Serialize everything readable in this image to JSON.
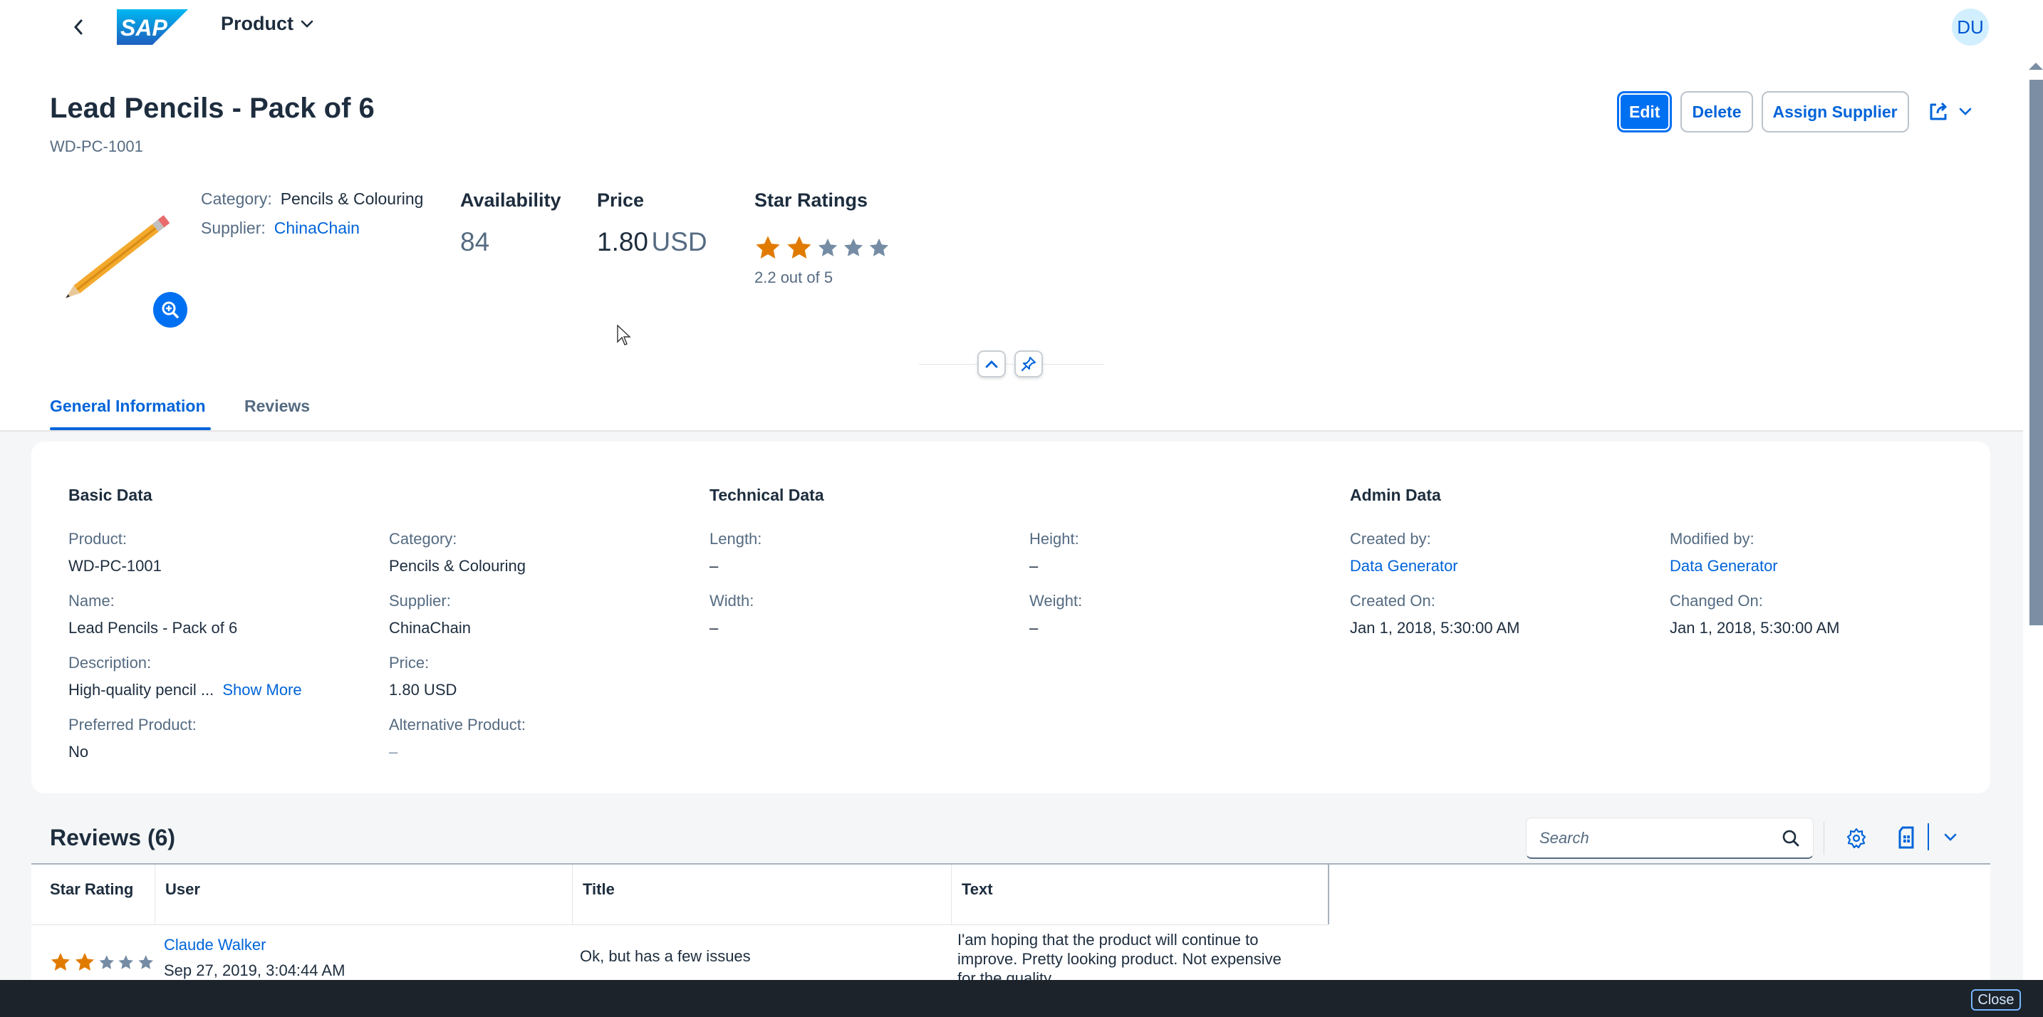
{
  "shell": {
    "app_title": "Product",
    "logo_text": "SAP",
    "avatar_initials": "DU"
  },
  "object_header": {
    "title": "Lead Pencils - Pack of 6",
    "subtitle": "WD-PC-1001",
    "category_label": "Category:",
    "category_value": "Pencils & Colouring",
    "supplier_label": "Supplier:",
    "supplier_value": "ChinaChain",
    "availability_label": "Availability",
    "availability_value": "84",
    "price_label": "Price",
    "price_value": "1.80",
    "price_unit": "USD",
    "rating_label": "Star Ratings",
    "rating_value": 2.2,
    "rating_max": 5,
    "rating_text": "2.2 out of 5",
    "actions": {
      "edit": "Edit",
      "delete": "Delete",
      "assign_supplier": "Assign Supplier"
    }
  },
  "tabs": [
    {
      "label": "General Information",
      "active": true
    },
    {
      "label": "Reviews",
      "active": false
    }
  ],
  "general_info": {
    "basic_data": {
      "title": "Basic Data",
      "fields": [
        {
          "label": "Product:",
          "value": "WD-PC-1001"
        },
        {
          "label": "Category:",
          "value": "Pencils & Colouring"
        },
        {
          "label": "Name:",
          "value": "Lead Pencils - Pack of 6"
        },
        {
          "label": "Supplier:",
          "value": "ChinaChain"
        },
        {
          "label": "Description:",
          "value": "High-quality pencil ...",
          "link": "Show More"
        },
        {
          "label": "Price:",
          "value": "1.80 USD"
        },
        {
          "label": "Preferred Product:",
          "value": "No"
        },
        {
          "label": "Alternative Product:",
          "value": "–"
        }
      ]
    },
    "technical_data": {
      "title": "Technical Data",
      "fields": [
        {
          "label": "Length:",
          "value": "–"
        },
        {
          "label": "Height:",
          "value": "–"
        },
        {
          "label": "Width:",
          "value": "–"
        },
        {
          "label": "Weight:",
          "value": "–"
        }
      ]
    },
    "admin_data": {
      "title": "Admin Data",
      "fields": [
        {
          "label": "Created by:",
          "value": "Data Generator"
        },
        {
          "label": "Modified by:",
          "value": "Data Generator"
        },
        {
          "label": "Created On:",
          "value": "Jan 1, 2018, 5:30:00 AM"
        },
        {
          "label": "Changed On:",
          "value": "Jan 1, 2018, 5:30:00 AM"
        }
      ]
    }
  },
  "reviews": {
    "title": "Reviews (6)",
    "search_placeholder": "Search",
    "columns": [
      "Star Rating",
      "User",
      "Title",
      "Text"
    ],
    "rows": [
      {
        "rating": 2,
        "user": "Claude Walker",
        "date": "Sep 27, 2019, 3:04:44 AM",
        "title": "Ok, but has a few issues",
        "text_lines": [
          "I'am hoping that the product will continue to",
          "improve. Pretty looking product. Not expensive",
          "for the quality."
        ]
      }
    ]
  },
  "bottom_bar": {
    "close_label": "Close"
  },
  "colors": {
    "brand": "#0070f2",
    "link": "#0064d9",
    "star_filled": "#e17b00",
    "star_empty": "#758ca4",
    "text": "#1d2d3e",
    "label": "#556b82"
  }
}
